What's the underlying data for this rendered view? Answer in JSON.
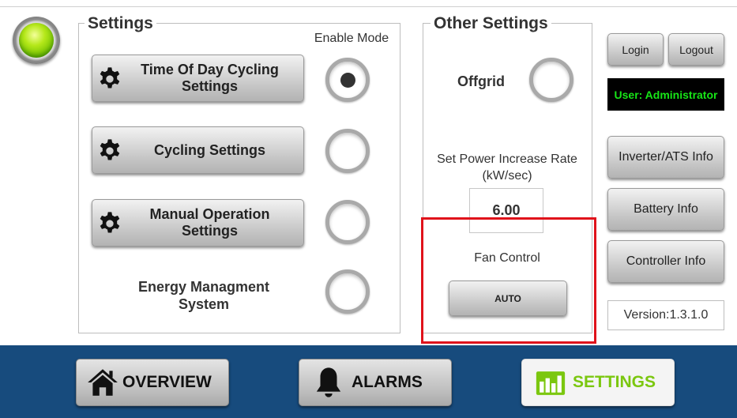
{
  "settings": {
    "title": "Settings",
    "enable_mode_label": "Enable Mode",
    "items": [
      {
        "label": "Time Of Day Cycling Settings",
        "enabled": true
      },
      {
        "label": "Cycling Settings",
        "enabled": false
      },
      {
        "label": "Manual Operation Settings",
        "enabled": false
      },
      {
        "label": "Energy Managment System",
        "enabled": false
      }
    ]
  },
  "other_settings": {
    "title": "Other Settings",
    "offgrid_label": "Offgrid",
    "offgrid_enabled": false,
    "power_rate_label": "Set Power Increase Rate (kW/sec)",
    "power_rate_value": "6.00",
    "fan_control_label": "Fan Control",
    "fan_mode": "AUTO"
  },
  "account": {
    "login_label": "Login",
    "logout_label": "Logout",
    "user_text": "User: Administrator"
  },
  "info_buttons": {
    "inverter": "Inverter/ATS Info",
    "battery": "Battery Info",
    "controller": "Controller Info"
  },
  "version_text": "Version:1.3.1.0",
  "nav": {
    "overview": "OVERVIEW",
    "alarms": "ALARMS",
    "settings": "SETTINGS",
    "active": "settings"
  },
  "colors": {
    "nav_background": "#174b7d",
    "active_tab_text": "#7bc70f",
    "user_text": "#17e617",
    "highlight_border": "#e0121b",
    "status_light": "#8fd400"
  },
  "icons": {
    "status": "green-status-light",
    "settings_items": "gear-icon",
    "overview": "house-icon",
    "alarms": "bell-icon",
    "settings": "bar-chart-icon"
  }
}
